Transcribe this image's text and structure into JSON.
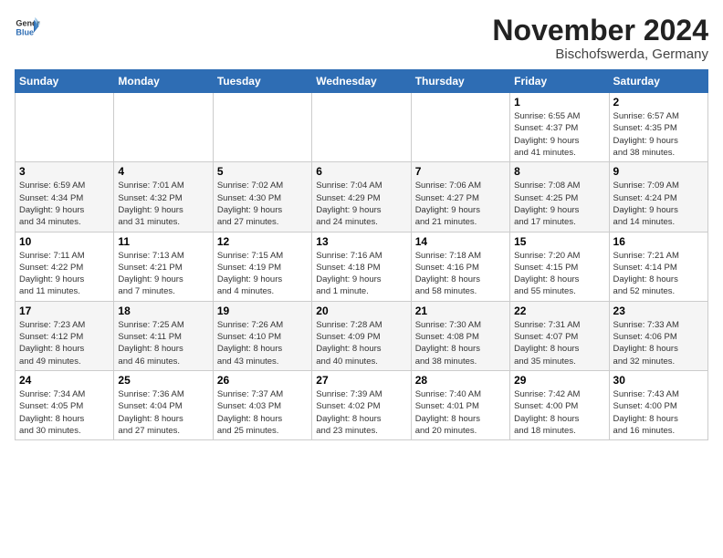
{
  "header": {
    "logo_line1": "General",
    "logo_line2": "Blue",
    "month": "November 2024",
    "location": "Bischofswerda, Germany"
  },
  "weekdays": [
    "Sunday",
    "Monday",
    "Tuesday",
    "Wednesday",
    "Thursday",
    "Friday",
    "Saturday"
  ],
  "weeks": [
    [
      {
        "day": "",
        "info": ""
      },
      {
        "day": "",
        "info": ""
      },
      {
        "day": "",
        "info": ""
      },
      {
        "day": "",
        "info": ""
      },
      {
        "day": "",
        "info": ""
      },
      {
        "day": "1",
        "info": "Sunrise: 6:55 AM\nSunset: 4:37 PM\nDaylight: 9 hours\nand 41 minutes."
      },
      {
        "day": "2",
        "info": "Sunrise: 6:57 AM\nSunset: 4:35 PM\nDaylight: 9 hours\nand 38 minutes."
      }
    ],
    [
      {
        "day": "3",
        "info": "Sunrise: 6:59 AM\nSunset: 4:34 PM\nDaylight: 9 hours\nand 34 minutes."
      },
      {
        "day": "4",
        "info": "Sunrise: 7:01 AM\nSunset: 4:32 PM\nDaylight: 9 hours\nand 31 minutes."
      },
      {
        "day": "5",
        "info": "Sunrise: 7:02 AM\nSunset: 4:30 PM\nDaylight: 9 hours\nand 27 minutes."
      },
      {
        "day": "6",
        "info": "Sunrise: 7:04 AM\nSunset: 4:29 PM\nDaylight: 9 hours\nand 24 minutes."
      },
      {
        "day": "7",
        "info": "Sunrise: 7:06 AM\nSunset: 4:27 PM\nDaylight: 9 hours\nand 21 minutes."
      },
      {
        "day": "8",
        "info": "Sunrise: 7:08 AM\nSunset: 4:25 PM\nDaylight: 9 hours\nand 17 minutes."
      },
      {
        "day": "9",
        "info": "Sunrise: 7:09 AM\nSunset: 4:24 PM\nDaylight: 9 hours\nand 14 minutes."
      }
    ],
    [
      {
        "day": "10",
        "info": "Sunrise: 7:11 AM\nSunset: 4:22 PM\nDaylight: 9 hours\nand 11 minutes."
      },
      {
        "day": "11",
        "info": "Sunrise: 7:13 AM\nSunset: 4:21 PM\nDaylight: 9 hours\nand 7 minutes."
      },
      {
        "day": "12",
        "info": "Sunrise: 7:15 AM\nSunset: 4:19 PM\nDaylight: 9 hours\nand 4 minutes."
      },
      {
        "day": "13",
        "info": "Sunrise: 7:16 AM\nSunset: 4:18 PM\nDaylight: 9 hours\nand 1 minute."
      },
      {
        "day": "14",
        "info": "Sunrise: 7:18 AM\nSunset: 4:16 PM\nDaylight: 8 hours\nand 58 minutes."
      },
      {
        "day": "15",
        "info": "Sunrise: 7:20 AM\nSunset: 4:15 PM\nDaylight: 8 hours\nand 55 minutes."
      },
      {
        "day": "16",
        "info": "Sunrise: 7:21 AM\nSunset: 4:14 PM\nDaylight: 8 hours\nand 52 minutes."
      }
    ],
    [
      {
        "day": "17",
        "info": "Sunrise: 7:23 AM\nSunset: 4:12 PM\nDaylight: 8 hours\nand 49 minutes."
      },
      {
        "day": "18",
        "info": "Sunrise: 7:25 AM\nSunset: 4:11 PM\nDaylight: 8 hours\nand 46 minutes."
      },
      {
        "day": "19",
        "info": "Sunrise: 7:26 AM\nSunset: 4:10 PM\nDaylight: 8 hours\nand 43 minutes."
      },
      {
        "day": "20",
        "info": "Sunrise: 7:28 AM\nSunset: 4:09 PM\nDaylight: 8 hours\nand 40 minutes."
      },
      {
        "day": "21",
        "info": "Sunrise: 7:30 AM\nSunset: 4:08 PM\nDaylight: 8 hours\nand 38 minutes."
      },
      {
        "day": "22",
        "info": "Sunrise: 7:31 AM\nSunset: 4:07 PM\nDaylight: 8 hours\nand 35 minutes."
      },
      {
        "day": "23",
        "info": "Sunrise: 7:33 AM\nSunset: 4:06 PM\nDaylight: 8 hours\nand 32 minutes."
      }
    ],
    [
      {
        "day": "24",
        "info": "Sunrise: 7:34 AM\nSunset: 4:05 PM\nDaylight: 8 hours\nand 30 minutes."
      },
      {
        "day": "25",
        "info": "Sunrise: 7:36 AM\nSunset: 4:04 PM\nDaylight: 8 hours\nand 27 minutes."
      },
      {
        "day": "26",
        "info": "Sunrise: 7:37 AM\nSunset: 4:03 PM\nDaylight: 8 hours\nand 25 minutes."
      },
      {
        "day": "27",
        "info": "Sunrise: 7:39 AM\nSunset: 4:02 PM\nDaylight: 8 hours\nand 23 minutes."
      },
      {
        "day": "28",
        "info": "Sunrise: 7:40 AM\nSunset: 4:01 PM\nDaylight: 8 hours\nand 20 minutes."
      },
      {
        "day": "29",
        "info": "Sunrise: 7:42 AM\nSunset: 4:00 PM\nDaylight: 8 hours\nand 18 minutes."
      },
      {
        "day": "30",
        "info": "Sunrise: 7:43 AM\nSunset: 4:00 PM\nDaylight: 8 hours\nand 16 minutes."
      }
    ]
  ]
}
